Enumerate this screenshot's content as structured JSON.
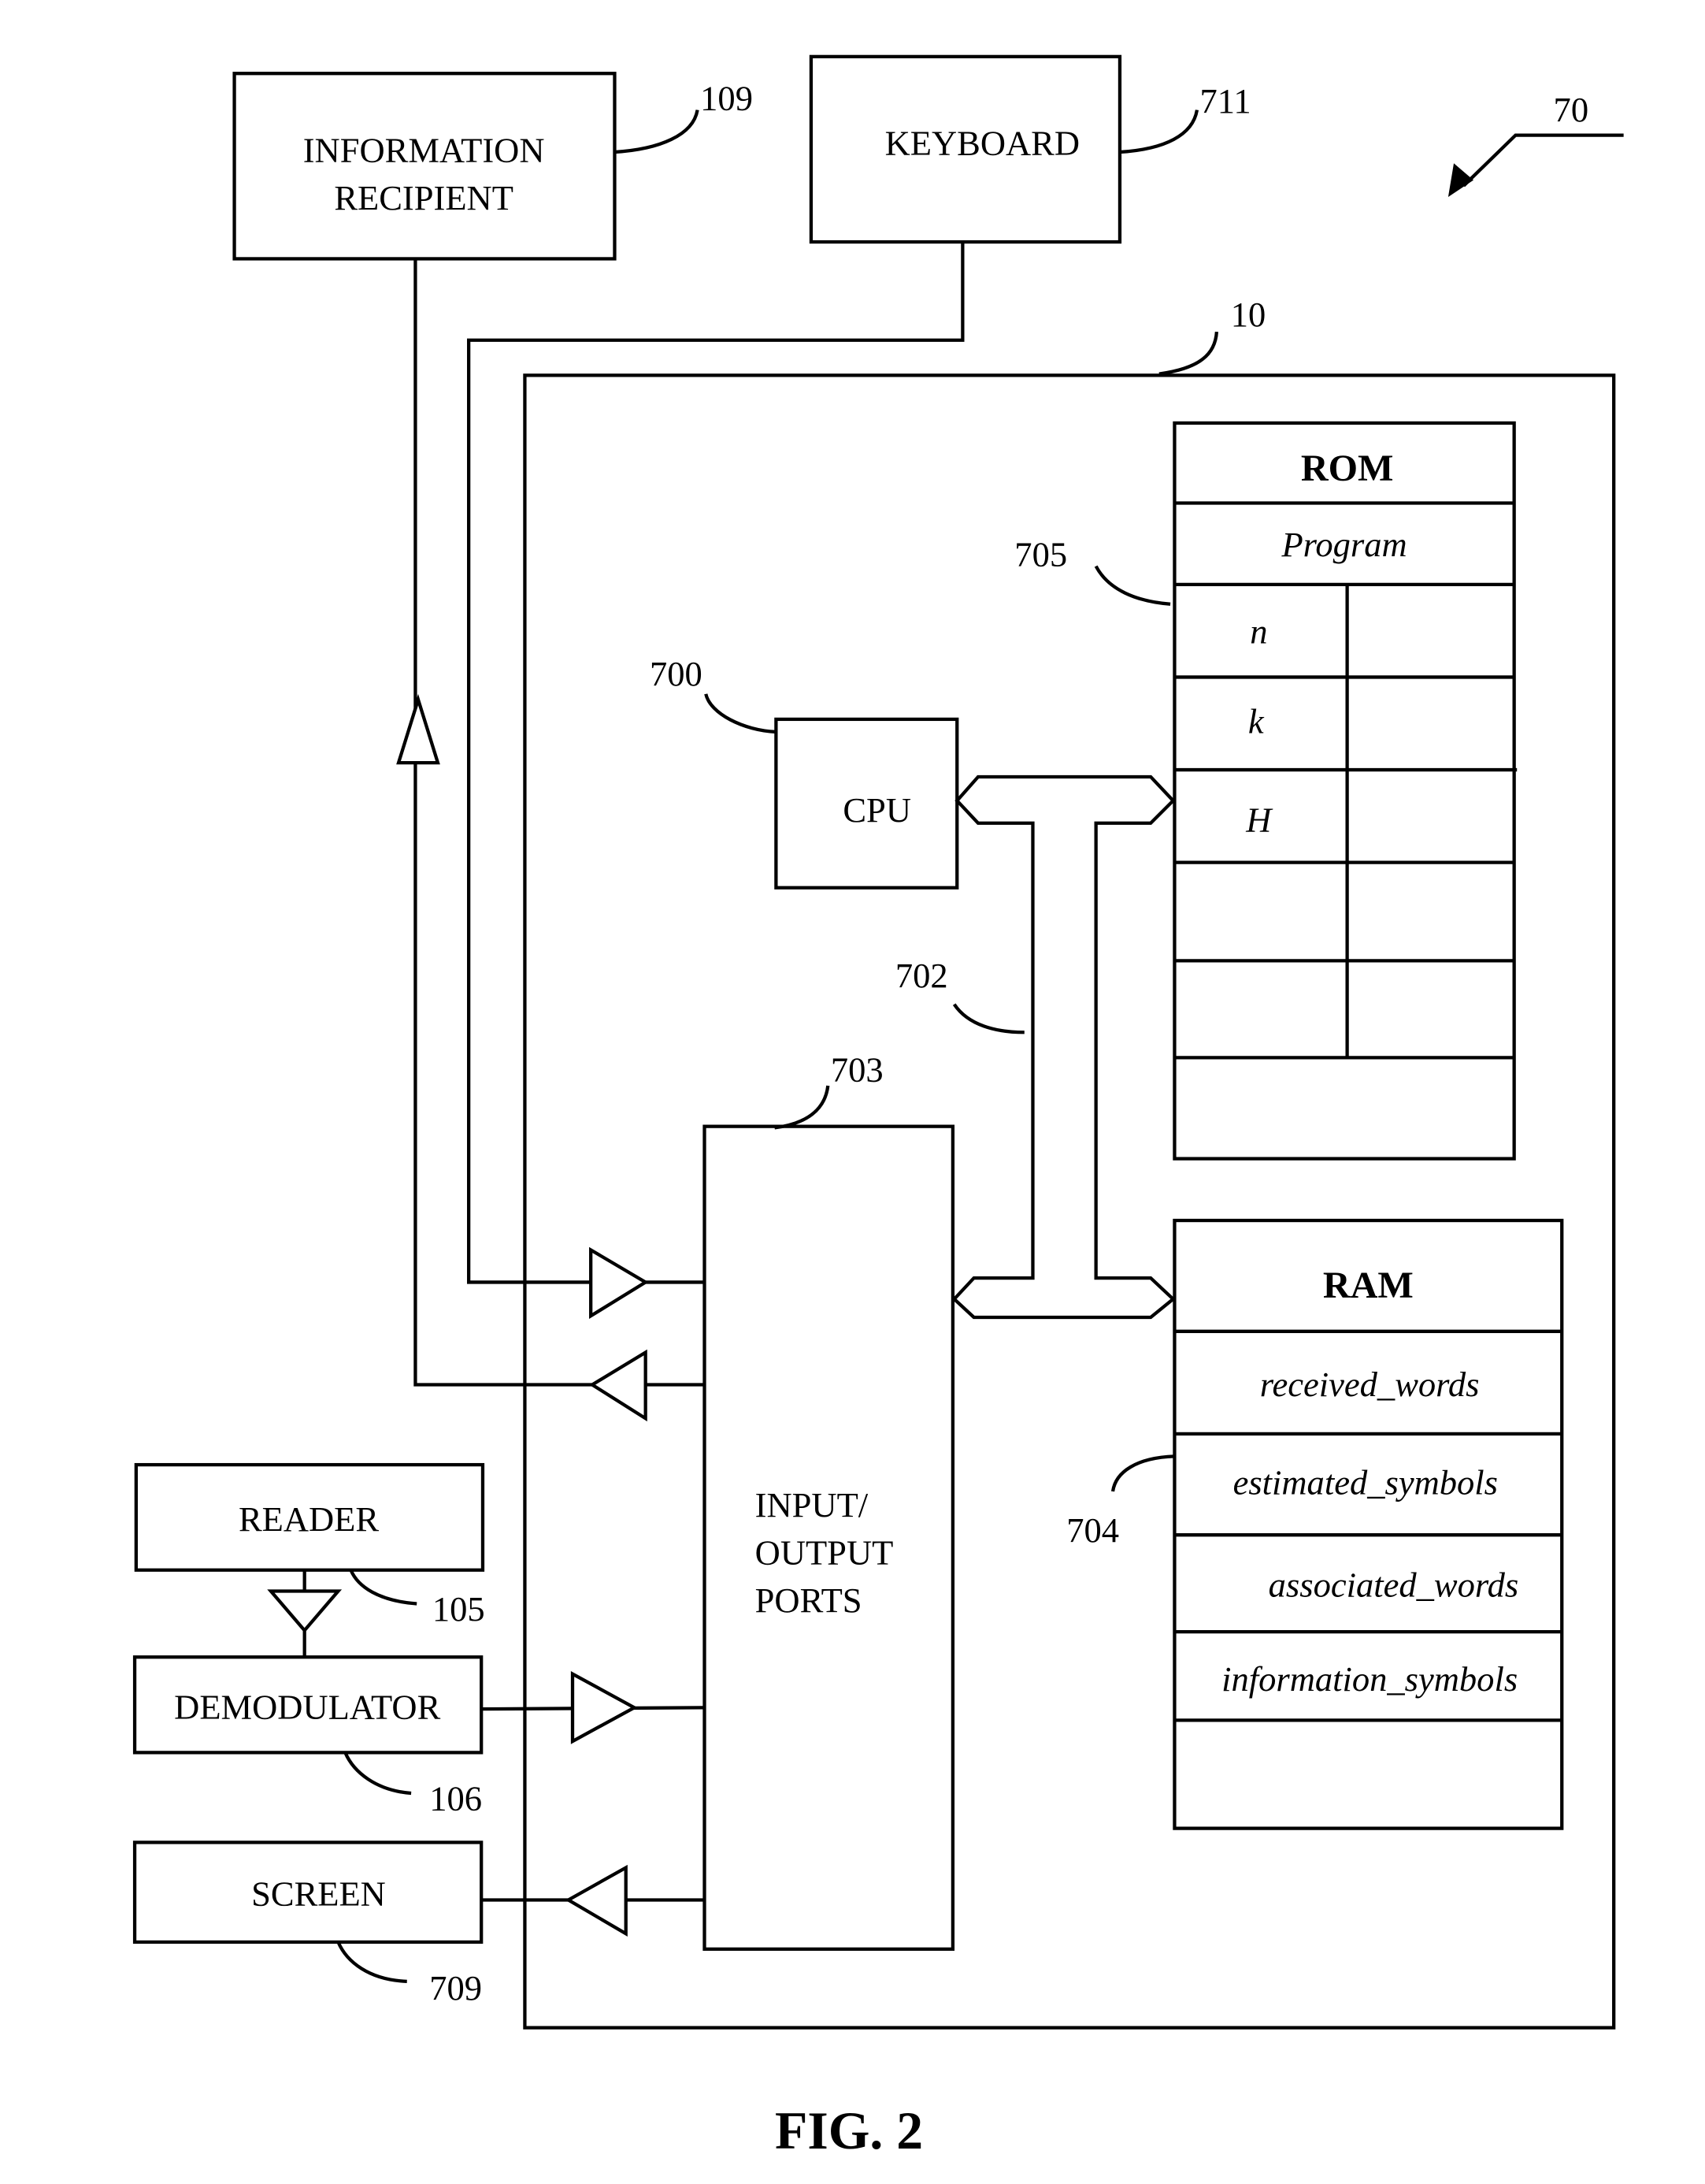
{
  "figure": {
    "caption": "FIG. 2",
    "system_ref": "70"
  },
  "components": {
    "information_recipient": {
      "label_line1": "INFORMATION",
      "label_line2": "RECIPIENT",
      "ref": "109"
    },
    "keyboard": {
      "label": "KEYBOARD",
      "ref": "711"
    },
    "device": {
      "ref": "10"
    },
    "cpu": {
      "label": "CPU",
      "ref": "700"
    },
    "bus": {
      "ref": "702"
    },
    "io_ports": {
      "label_line1": "INPUT/",
      "label_line2": "OUTPUT",
      "label_line3": "PORTS",
      "ref": "703"
    },
    "rom": {
      "title": "ROM",
      "ref": "705",
      "program": "Program",
      "rows": [
        "n",
        "k",
        "H",
        "",
        ""
      ]
    },
    "ram": {
      "title": "RAM",
      "ref": "704",
      "rows": [
        "received_words",
        "estimated_symbols",
        "associated_words",
        "information_symbols",
        ""
      ]
    },
    "reader": {
      "label": "READER",
      "ref": "105"
    },
    "demodulator": {
      "label": "DEMODULATOR",
      "ref": "106"
    },
    "screen": {
      "label": "SCREEN",
      "ref": "709"
    }
  }
}
